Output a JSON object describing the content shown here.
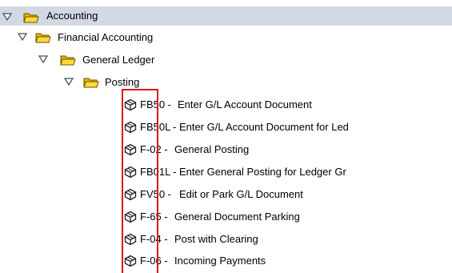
{
  "tree": {
    "nodes": [
      {
        "label": "Accounting"
      },
      {
        "label": "Financial Accounting"
      },
      {
        "label": "General Ledger"
      },
      {
        "label": "Posting"
      }
    ],
    "transactions": [
      {
        "code": "FB50 - ",
        "desc": "Enter G/L Account Document"
      },
      {
        "code": "FB50L",
        "desc": " - Enter G/L Account Document for Led"
      },
      {
        "code": "F-02 - ",
        "desc": "General Posting"
      },
      {
        "code": "FB01L",
        "desc": " - Enter General Posting for Ledger Gr"
      },
      {
        "code": "FV50 - ",
        "desc": "Edit or Park G/L Document"
      },
      {
        "code": "F-65 - ",
        "desc": "General Document Parking"
      },
      {
        "code": "F-04 - ",
        "desc": "Post with Clearing"
      },
      {
        "code": "F-06 - ",
        "desc": "Incoming Payments"
      }
    ]
  },
  "colors": {
    "highlight_row": "#d3d9e4",
    "folder": "#f2c200",
    "annotation_box": "#e0141b"
  },
  "icons": {
    "expand": "triangle-down-icon",
    "folder": "open-folder-icon",
    "transaction": "transaction-cube-icon"
  }
}
